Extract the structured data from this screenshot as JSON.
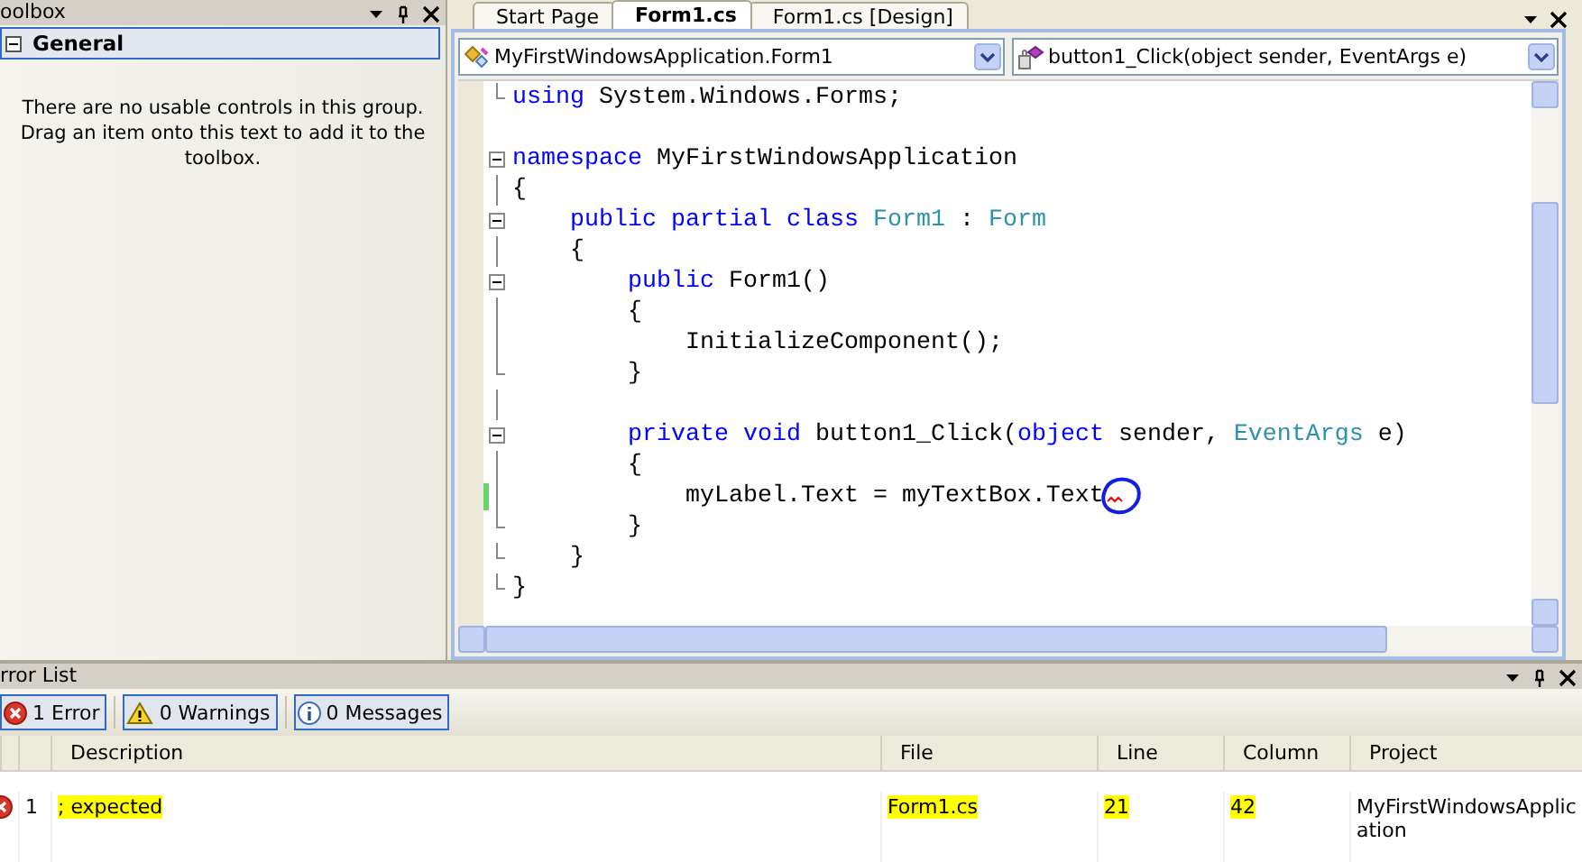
{
  "toolbox": {
    "title": "oolbox",
    "group": {
      "label": "General",
      "expanded": true
    },
    "empty_message": "There are no usable controls in this group. Drag an item onto this text to add it to the toolbox."
  },
  "editor": {
    "tabs": [
      {
        "label": "Start Page",
        "selected": false
      },
      {
        "label": "Form1.cs",
        "selected": true
      },
      {
        "label": "Form1.cs [Design]",
        "selected": false
      }
    ],
    "type_dropdown": {
      "value": "MyFirstWindowsApplication.Form1"
    },
    "member_dropdown": {
      "value": "button1_Click(object sender, EventArgs e)"
    },
    "code_lines": [
      {
        "kind": "fold_end",
        "changed": false,
        "annotated": false,
        "tokens": [
          {
            "kind": "keyword",
            "text": "using"
          },
          {
            "kind": "plain",
            "text": " System.Windows.Forms;"
          }
        ]
      },
      {
        "kind": "blank",
        "changed": false,
        "annotated": false
      },
      {
        "kind": "fold_start",
        "changed": false,
        "annotated": false,
        "tokens": [
          {
            "kind": "keyword",
            "text": "namespace"
          },
          {
            "kind": "plain",
            "text": " MyFirstWindowsApplication"
          }
        ]
      },
      {
        "kind": "fold_mid",
        "changed": false,
        "annotated": false,
        "tokens": [
          {
            "kind": "plain",
            "text": "{"
          }
        ]
      },
      {
        "kind": "fold_start",
        "changed": false,
        "annotated": false,
        "tokens": [
          {
            "kind": "keyword",
            "text": "    public partial class "
          },
          {
            "kind": "type",
            "text": "Form1"
          },
          {
            "kind": "plain",
            "text": " : "
          },
          {
            "kind": "type",
            "text": "Form"
          }
        ]
      },
      {
        "kind": "fold_mid",
        "changed": false,
        "annotated": false,
        "tokens": [
          {
            "kind": "plain",
            "text": "    {"
          }
        ]
      },
      {
        "kind": "fold_start",
        "changed": false,
        "annotated": false,
        "tokens": [
          {
            "kind": "keyword",
            "text": "        public"
          },
          {
            "kind": "plain",
            "text": " Form1()"
          }
        ]
      },
      {
        "kind": "fold_mid",
        "changed": false,
        "annotated": false,
        "tokens": [
          {
            "kind": "plain",
            "text": "        {"
          }
        ]
      },
      {
        "kind": "fold_mid",
        "changed": false,
        "annotated": false,
        "tokens": [
          {
            "kind": "plain",
            "text": "            InitializeComponent();"
          }
        ]
      },
      {
        "kind": "fold_end",
        "changed": false,
        "annotated": false,
        "tokens": [
          {
            "kind": "plain",
            "text": "        }"
          }
        ]
      },
      {
        "kind": "fold_mid",
        "changed": false,
        "annotated": false
      },
      {
        "kind": "fold_start",
        "changed": false,
        "annotated": false,
        "tokens": [
          {
            "kind": "keyword",
            "text": "        private void"
          },
          {
            "kind": "plain",
            "text": " button1_Click("
          },
          {
            "kind": "keyword",
            "text": "object"
          },
          {
            "kind": "plain",
            "text": " sender, "
          },
          {
            "kind": "type",
            "text": "EventArgs"
          },
          {
            "kind": "plain",
            "text": " e)"
          }
        ]
      },
      {
        "kind": "fold_mid",
        "changed": false,
        "annotated": false,
        "tokens": [
          {
            "kind": "plain",
            "text": "        {"
          }
        ]
      },
      {
        "kind": "fold_mid",
        "changed": true,
        "annotated": true,
        "tokens": [
          {
            "kind": "plain",
            "text": "            myLabel.Text = myTextBox.Text"
          }
        ]
      },
      {
        "kind": "fold_end",
        "changed": false,
        "annotated": false,
        "tokens": [
          {
            "kind": "plain",
            "text": "        }"
          }
        ]
      },
      {
        "kind": "fold_end",
        "changed": false,
        "annotated": false,
        "tokens": [
          {
            "kind": "plain",
            "text": "    }"
          }
        ]
      },
      {
        "kind": "fold_end",
        "changed": false,
        "annotated": false,
        "tokens": [
          {
            "kind": "plain",
            "text": "}"
          }
        ]
      }
    ]
  },
  "error_list": {
    "title": "rror List",
    "filters": [
      {
        "kind": "error",
        "label": "1 Error",
        "selected": true
      },
      {
        "kind": "warning",
        "label": "0 Warnings",
        "selected": true
      },
      {
        "kind": "info",
        "label": "0 Messages",
        "selected": true
      }
    ],
    "columns": [
      "Description",
      "File",
      "Line",
      "Column",
      "Project"
    ],
    "rows": [
      {
        "kind": "error",
        "number": "1",
        "description": "; expected",
        "file": "Form1.cs",
        "line": "21",
        "column": "42",
        "project": "MyFirstWindowsApplication",
        "highlighted": [
          true,
          true,
          true,
          true,
          false
        ]
      }
    ]
  }
}
